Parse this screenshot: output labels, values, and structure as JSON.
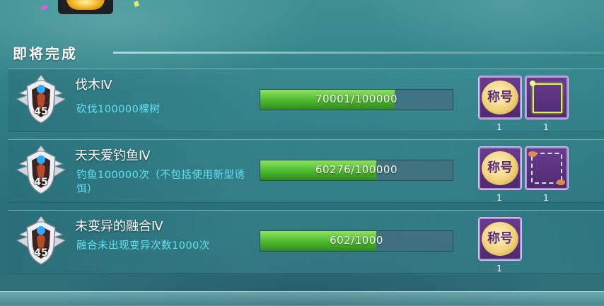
{
  "section": {
    "title": "即将完成"
  },
  "achievements": [
    {
      "badge_level": "45",
      "title": "伐木Ⅳ",
      "description": "砍伐100000棵树",
      "progress": {
        "current": 70001,
        "total": 100000,
        "text": "70001/100000"
      },
      "rewards": [
        {
          "kind": "title-medal",
          "label": "称号",
          "count": "1"
        },
        {
          "kind": "lime-frame",
          "count": "1"
        }
      ]
    },
    {
      "badge_level": "45",
      "title": "天天爱钓鱼Ⅳ",
      "description": "钓鱼100000次（不包括使用新型诱饵）",
      "progress": {
        "current": 60276,
        "total": 100000,
        "text": "60276/100000"
      },
      "rewards": [
        {
          "kind": "title-medal",
          "label": "称号",
          "count": "1"
        },
        {
          "kind": "fish-frame",
          "count": "1"
        }
      ]
    },
    {
      "badge_level": "45",
      "title": "未变异的融合Ⅳ",
      "description": "融合未出现变异次数1000次",
      "progress": {
        "current": 602,
        "total": 1000,
        "text": "602/1000"
      },
      "rewards": [
        {
          "kind": "title-medal",
          "label": "称号",
          "count": "1"
        }
      ]
    }
  ],
  "colors": {
    "progress_fill": "#4cb82e",
    "description": "#63e1f0",
    "reward_bg": "#5a3380"
  },
  "icons": {
    "badge": "winged-shield-badge-icon",
    "trophy": "trophy-icon"
  }
}
